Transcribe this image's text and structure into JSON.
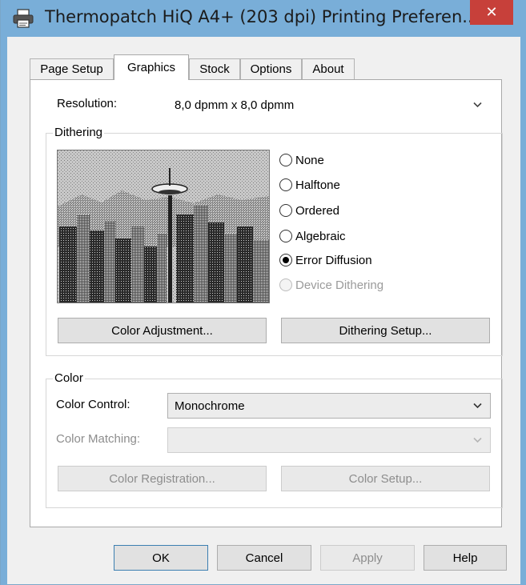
{
  "window": {
    "title": "Thermopatch HiQ A4+ (203 dpi) Printing Preferen...",
    "close_glyph": "✕",
    "title_bar_color": "#79aed8",
    "close_button_color": "#c7403a"
  },
  "tabs": [
    {
      "label": "Page Setup",
      "active": false
    },
    {
      "label": "Graphics",
      "active": true
    },
    {
      "label": "Stock",
      "active": false
    },
    {
      "label": "Options",
      "active": false
    },
    {
      "label": "About",
      "active": false
    }
  ],
  "graphics": {
    "resolution_label": "Resolution:",
    "resolution_value": "8,0 dpmm x 8,0 dpmm",
    "dithering": {
      "group_label": "Dithering",
      "options": [
        {
          "label": "None",
          "checked": false,
          "enabled": true
        },
        {
          "label": "Halftone",
          "checked": false,
          "enabled": true
        },
        {
          "label": "Ordered",
          "checked": false,
          "enabled": true
        },
        {
          "label": "Algebraic",
          "checked": false,
          "enabled": true
        },
        {
          "label": "Error Diffusion",
          "checked": true,
          "enabled": true
        },
        {
          "label": "Device Dithering",
          "checked": false,
          "enabled": false
        }
      ],
      "color_adjustment_button": "Color Adjustment...",
      "dithering_setup_button": "Dithering Setup..."
    },
    "color": {
      "group_label": "Color",
      "color_control_label": "Color Control:",
      "color_control_value": "Monochrome",
      "color_matching_label": "Color Matching:",
      "color_matching_value": "",
      "color_registration_button": "Color Registration...",
      "color_setup_button": "Color Setup..."
    }
  },
  "footer": {
    "ok": "OK",
    "cancel": "Cancel",
    "apply": "Apply",
    "help": "Help"
  },
  "icons": {
    "title_icon": "printer-icon",
    "dropdown_icon": "chevron-down-icon",
    "preview_image": "city-skyline-dithered-image"
  }
}
